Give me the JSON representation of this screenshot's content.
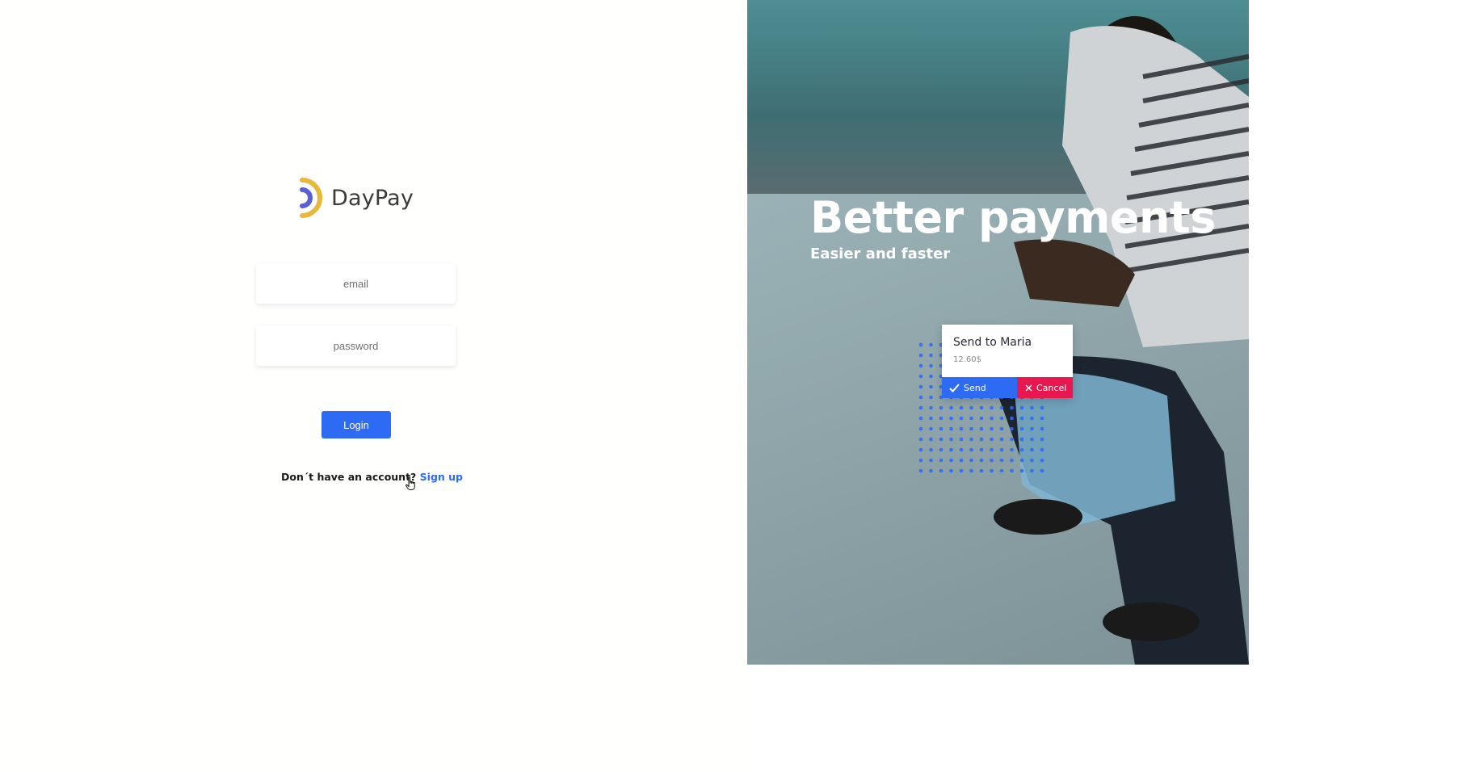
{
  "brand": {
    "name": "DayPay",
    "logo_colors": {
      "outer_arc": "#e8b83a",
      "inner_arc": "#5b5fd6"
    }
  },
  "login_form": {
    "email_placeholder": "email",
    "password_placeholder": "password",
    "login_label": "Login",
    "signup_prompt": "Don´t have an account?",
    "signup_link": "Sign up"
  },
  "hero": {
    "title": "Better payments",
    "subtitle": "Easier and faster"
  },
  "payment_card": {
    "title": "Send to Maria",
    "amount": "12.60$",
    "send_label": "Send",
    "cancel_label": "Cancel"
  },
  "colors": {
    "primary": "#2d6bf5",
    "danger": "#e8174f"
  },
  "icons": {
    "send": "check-icon",
    "cancel": "close-icon",
    "cursor": "hand-pointer-icon"
  }
}
